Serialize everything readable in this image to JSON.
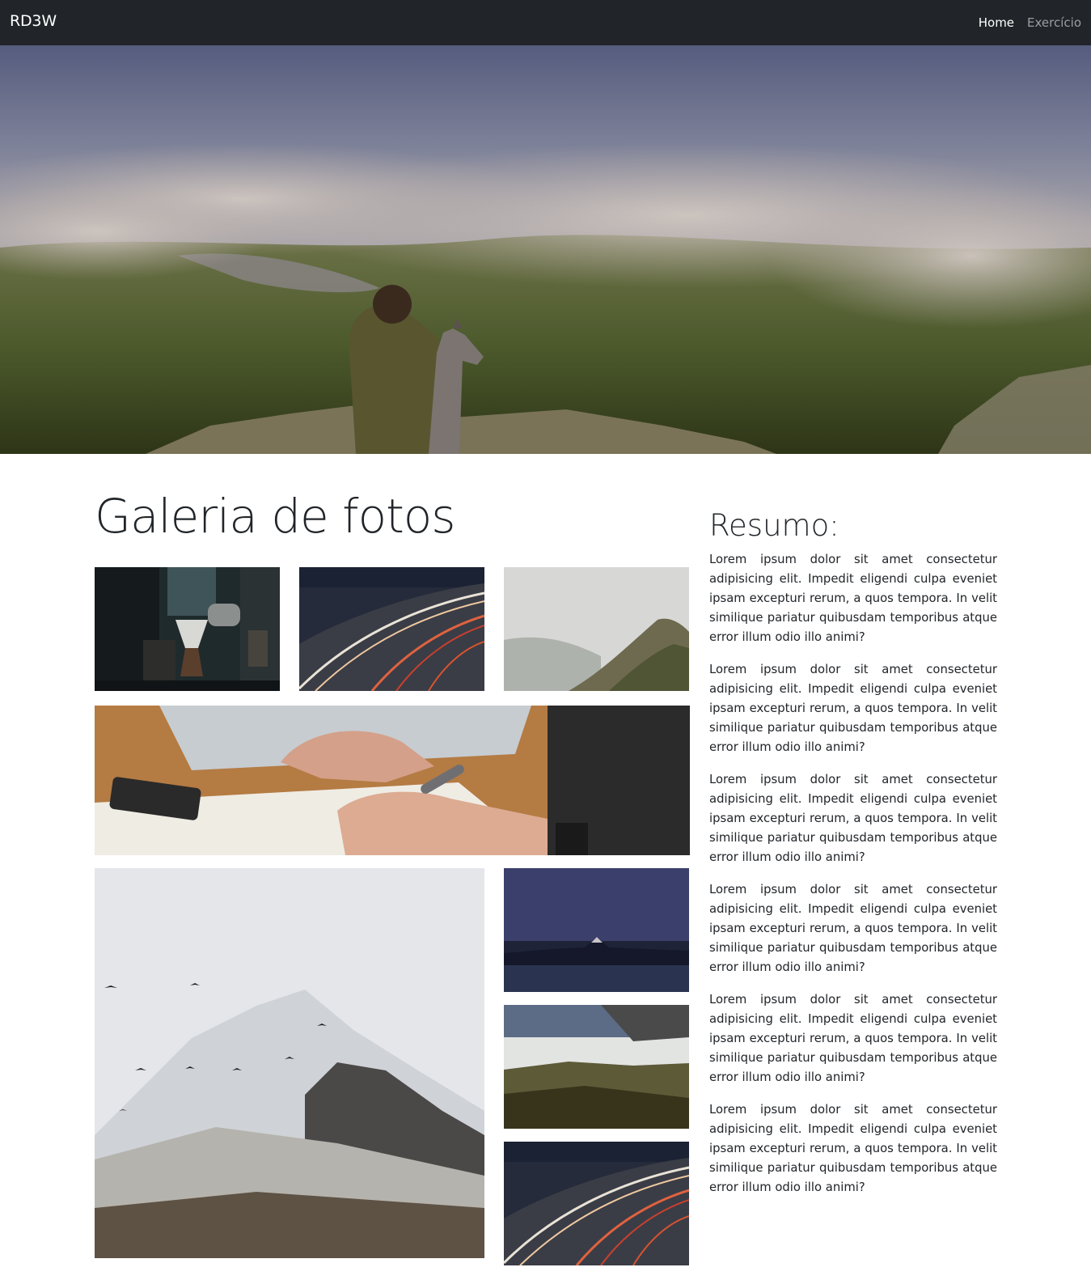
{
  "navbar": {
    "brand": "RD3W",
    "links": [
      {
        "label": "Home",
        "active": true
      },
      {
        "label": "Exercício",
        "active": false
      }
    ]
  },
  "hero": {
    "image": "mountain-clouds-woman-dog-photo"
  },
  "gallery": {
    "title": "Galeria de fotos",
    "photos": [
      {
        "name": "coffee-brewing-photo"
      },
      {
        "name": "night-road-light-trails-photo"
      },
      {
        "name": "foggy-cliff-photo"
      },
      {
        "name": "hand-writing-notebook-photo"
      },
      {
        "name": "snowy-mountain-birds-photo"
      },
      {
        "name": "night-volcano-lake-photo"
      },
      {
        "name": "hills-sunset-photo"
      },
      {
        "name": "night-road-light-trails-photo-2"
      }
    ]
  },
  "resumo": {
    "title": "Resumo:",
    "paragraphs": [
      "Lorem ipsum dolor sit amet consectetur adipisicing elit. Impedit eligendi culpa eveniet ipsam excepturi rerum, a quos tempora. In velit similique pariatur quibusdam temporibus atque error illum odio illo animi?",
      "Lorem ipsum dolor sit amet consectetur adipisicing elit. Impedit eligendi culpa eveniet ipsam excepturi rerum, a quos tempora. In velit similique pariatur quibusdam temporibus atque error illum odio illo animi?",
      "Lorem ipsum dolor sit amet consectetur adipisicing elit. Impedit eligendi culpa eveniet ipsam excepturi rerum, a quos tempora. In velit similique pariatur quibusdam temporibus atque error illum odio illo animi?",
      "Lorem ipsum dolor sit amet consectetur adipisicing elit. Impedit eligendi culpa eveniet ipsam excepturi rerum, a quos tempora. In velit similique pariatur quibusdam temporibus atque error illum odio illo animi?",
      "Lorem ipsum dolor sit amet consectetur adipisicing elit. Impedit eligendi culpa eveniet ipsam excepturi rerum, a quos tempora. In velit similique pariatur quibusdam temporibus atque error illum odio illo animi?",
      "Lorem ipsum dolor sit amet consectetur adipisicing elit. Impedit eligendi culpa eveniet ipsam excepturi rerum, a quos tempora. In velit similique pariatur quibusdam temporibus atque error illum odio illo animi?"
    ]
  },
  "colors": {
    "navbar_bg": "#212529",
    "nav_active": "#ffffff",
    "nav_inactive": "#8c8f92",
    "text": "#212529"
  }
}
